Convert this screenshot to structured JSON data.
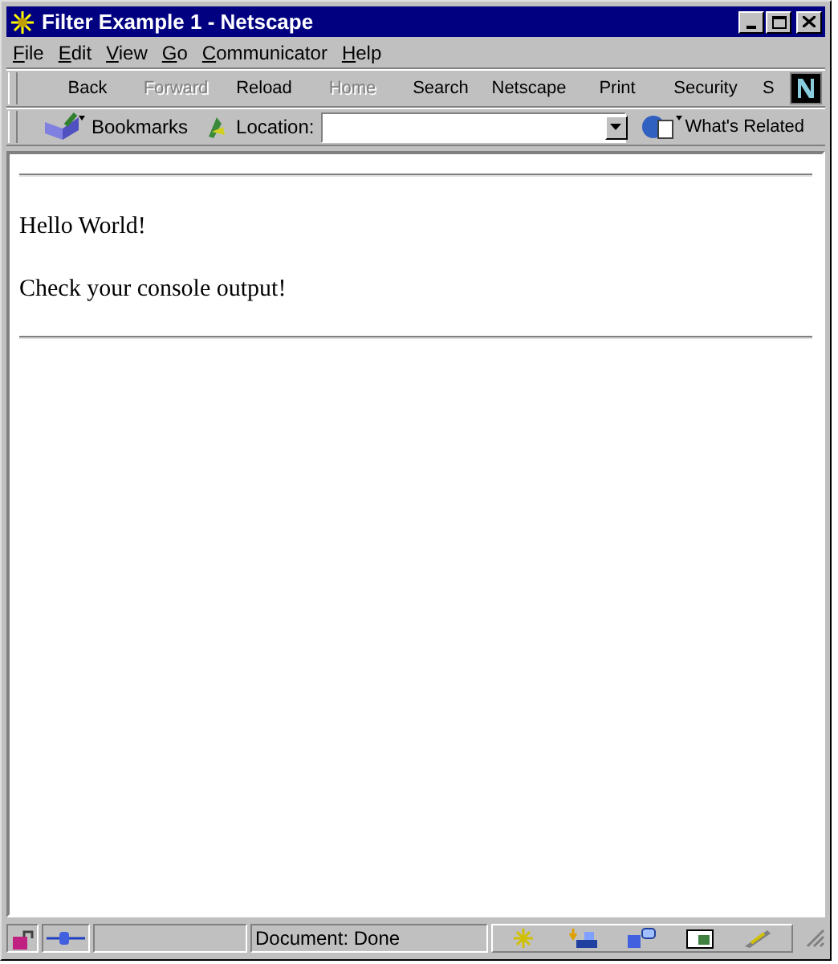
{
  "window": {
    "title": "Filter Example 1 - Netscape"
  },
  "menu": [
    "File",
    "Edit",
    "View",
    "Go",
    "Communicator",
    "Help"
  ],
  "toolbar": [
    {
      "label": "Back",
      "disabled": false
    },
    {
      "label": "Forward",
      "disabled": true
    },
    {
      "label": "Reload",
      "disabled": false
    },
    {
      "label": "Home",
      "disabled": true
    },
    {
      "label": "Search",
      "disabled": false
    },
    {
      "label": "Netscape",
      "disabled": false
    },
    {
      "label": "Print",
      "disabled": false
    },
    {
      "label": "Security",
      "disabled": false
    },
    {
      "label": "S",
      "disabled": false
    }
  ],
  "location_bar": {
    "bookmarks": "Bookmarks",
    "location_label": "Location:",
    "whats_related": "What's Related"
  },
  "content": {
    "paragraphs": [
      "Hello World!",
      "Check your console output!"
    ]
  },
  "status_bar": {
    "progress": {
      "level": 0
    },
    "text": "Document: Done"
  }
}
